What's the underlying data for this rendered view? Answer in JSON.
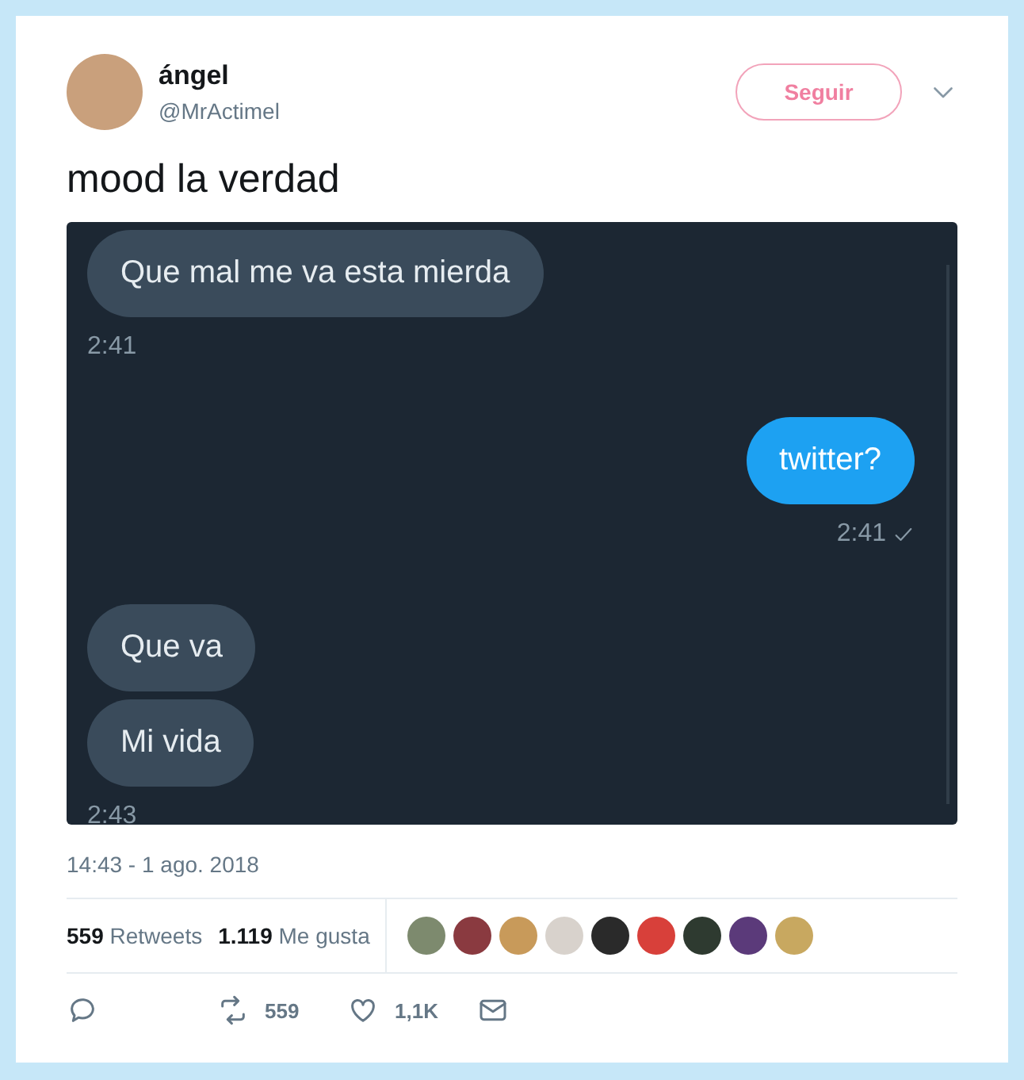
{
  "author": {
    "name": "ángel",
    "handle": "@MrActimel"
  },
  "follow_button": "Seguir",
  "text": "mood la verdad",
  "chat": {
    "groups": [
      {
        "kind": "received",
        "bubbles": [
          "Que mal me va esta mierda"
        ],
        "time": "2:41",
        "delivered": false
      },
      {
        "kind": "sent",
        "bubbles": [
          "twitter?"
        ],
        "time": "2:41",
        "delivered": true
      },
      {
        "kind": "received",
        "bubbles": [
          "Que va",
          "Mi vida"
        ],
        "time": "2:43",
        "delivered": false
      }
    ]
  },
  "date": "14:43 - 1 ago. 2018",
  "stats": [
    {
      "count": "559",
      "label": "Retweets"
    },
    {
      "count": "1.119",
      "label": "Me gusta"
    }
  ],
  "likers": [
    {
      "color": "#7d8a6e"
    },
    {
      "color": "#8a3a40"
    },
    {
      "color": "#c89a5a"
    },
    {
      "color": "#d8d2cc"
    },
    {
      "color": "#2a2a2a"
    },
    {
      "color": "#d8403a"
    },
    {
      "color": "#2e3a30"
    },
    {
      "color": "#5b3a7a"
    },
    {
      "color": "#c8a860"
    }
  ],
  "actions": [
    {
      "kind": "reply"
    },
    {
      "kind": "retweet",
      "count": "559"
    },
    {
      "kind": "like",
      "count": "1,1K"
    },
    {
      "kind": "message"
    }
  ]
}
